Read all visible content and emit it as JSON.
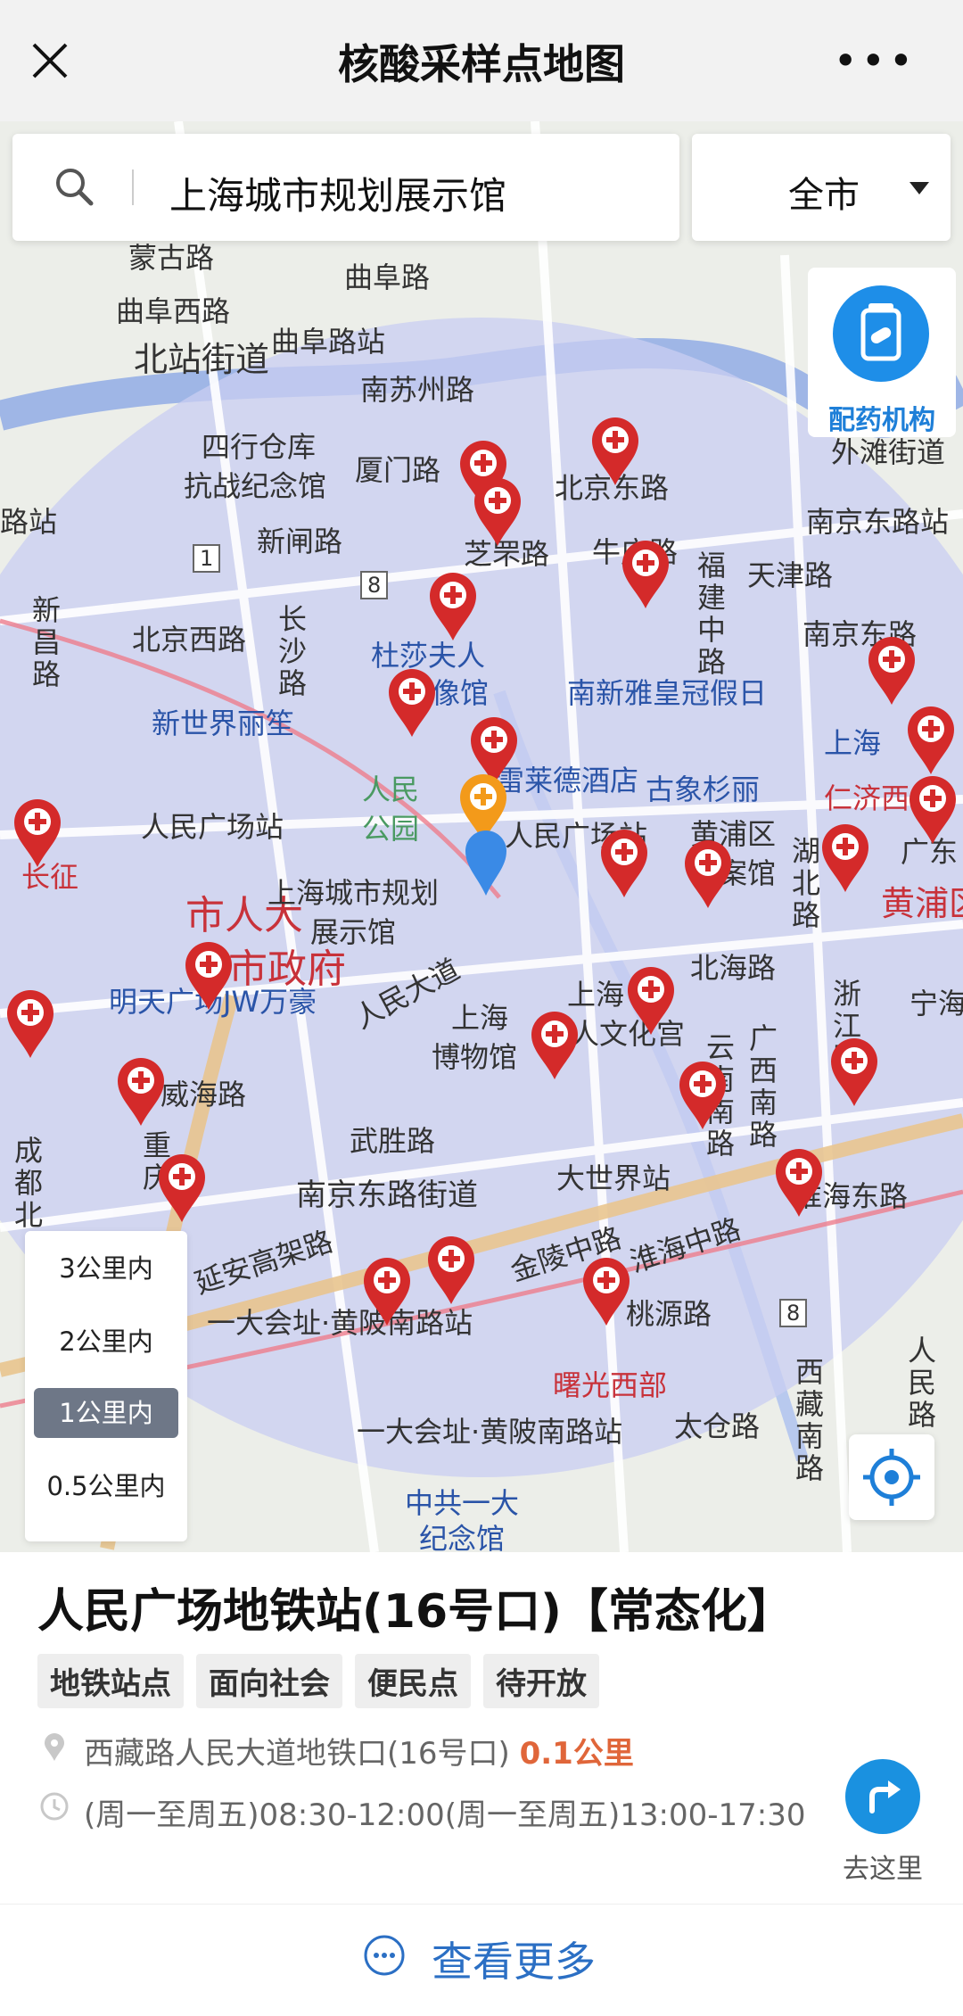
{
  "header": {
    "title": "核酸采样点地图",
    "close_icon": "close-icon",
    "more_icon": "more-dots-icon",
    "more_glyph": "•••"
  },
  "search": {
    "value": "上海城市规划展示馆",
    "icon": "search-icon"
  },
  "city_select": {
    "value": "全市",
    "icon": "caret-down-icon"
  },
  "pharmacy_button": {
    "label": "配药机构",
    "icon": "pharmacy-icon"
  },
  "radius_options": [
    {
      "label": "3公里内",
      "selected": false
    },
    {
      "label": "2公里内",
      "selected": false
    },
    {
      "label": "1公里内",
      "selected": true
    },
    {
      "label": "0.5公里内",
      "selected": false
    }
  ],
  "map": {
    "labels": {
      "menggu": "蒙古路",
      "qufuxi": "曲阜西路",
      "qufu": "曲阜路",
      "qufu_station": "曲阜路站",
      "beizhan": "北站街道",
      "nansuzhou": "南苏州路",
      "sihang1": "四行仓库",
      "sihang2": "抗战纪念馆",
      "xiamen": "厦门路",
      "beijingdong": "北京东路",
      "waitan": "外滩街道",
      "luzhan": "路站",
      "xinzha": "新闸路",
      "zhiyuan": "芝罘路",
      "niuzhuang": "牛庄路",
      "nanjingdong1": "南京东路站",
      "fujian": "福建中路",
      "tianjin": "天津路",
      "xinchang": "新昌路",
      "beijingxi": "北京西路",
      "changsha": "长沙路",
      "tussauds1": "杜莎夫人",
      "tussauds2": "蜡像馆",
      "nanxinya": "南新雅皇冠假日",
      "nanjingdong2": "南京东路",
      "newworld": "新世界丽笙",
      "shanghai1": "上海",
      "renmin_park1": "人民",
      "renmin_park2": "公园",
      "radisson": "雷莱德酒店",
      "gexiang": "古象杉丽",
      "renji": "仁济西",
      "rmgc_station": "人民广场站",
      "rmgc_station2": "人民广场站",
      "huangpu_dist1": "黄浦区",
      "huangpu_dist2": "档案馆",
      "hubei": "湖北路",
      "guangdong": "广东",
      "changzheng": "长征",
      "huangpu_big": "黄浦区",
      "gov1": "市人大",
      "gov2": "市政府",
      "planning1": "上海城市规划",
      "planning2": "展示馆",
      "mingtian": "明天广场JW万豪",
      "renmin_ave": "人民大道",
      "beihai": "北海路",
      "museum1": "上海",
      "museum2": "博物馆",
      "wenhua1": "上海",
      "wenhua2": "人文化宫",
      "zhejiang": "浙江路",
      "ningbo": "宁海",
      "weihai": "威海路",
      "yunnan": "云南南路",
      "guangxi": "广西南路",
      "chongqing": "重庆",
      "chengdu": "成都北",
      "wusheng": "武胜路",
      "dashijie": "大世界站",
      "nanjingdong_street": "南京东路街道",
      "huaihaidong": "淮海东路",
      "yanan": "延安高架路",
      "jinling": "金陵中路",
      "huaihaizhong": "淮海中路",
      "taoyuan": "桃源路",
      "yida1": "一大会址·黄陂南路站",
      "shuguang": "曙光西部",
      "xizang": "西藏南路",
      "renmin_rd": "人民路",
      "yida2": "一大会址·黄陂南路站",
      "taicang": "太仓路",
      "jinian1": "中共一大",
      "jinian2": "纪念馆",
      "metro8a": "8",
      "metro1": "1",
      "metro8b": "8"
    }
  },
  "detail": {
    "title": "人民广场地铁站(16号口)【常态化】",
    "tags": [
      "地铁站点",
      "面向社会",
      "便民点",
      "待开放"
    ],
    "address": "西藏路人民大道地铁口(16号口)",
    "distance": "0.1公里",
    "hours": "(周一至周五)08:30-12:00(周一至周五)13:00-17:30",
    "go_label": "去这里",
    "location_icon": "location-pin-icon",
    "clock_icon": "clock-icon",
    "navigate_icon": "navigate-arrow-icon"
  },
  "more": {
    "label": "查看更多",
    "icon": "more-circle-icon"
  },
  "colors": {
    "accent_blue": "#1e8ee8",
    "pin_red": "#d42a2a",
    "selected_pin_orange": "#f39a1a",
    "distance_orange": "#e0663a",
    "radius_fill": "#c9cdf2"
  }
}
